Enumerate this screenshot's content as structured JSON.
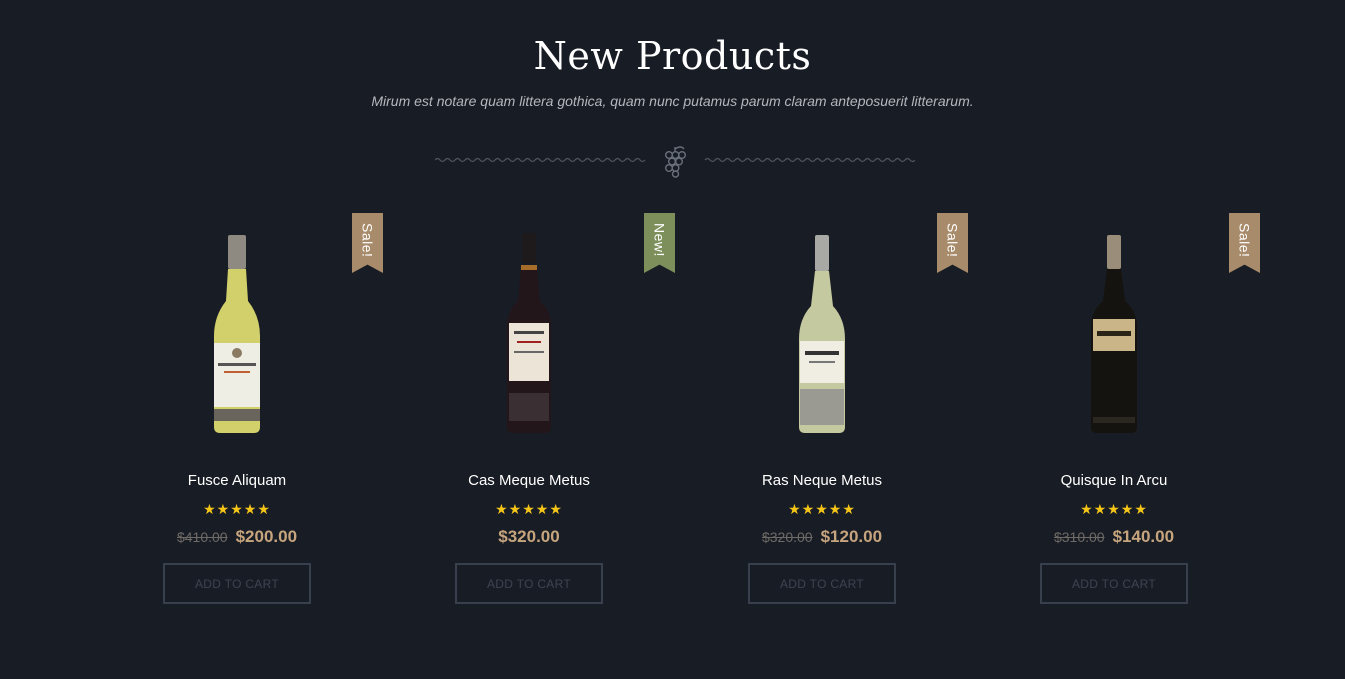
{
  "section": {
    "title": "New Products",
    "subtitle": "Mirum est notare quam littera gothica, quam nunc putamus parum claram anteposuerit litterarum."
  },
  "divider": {
    "icon": "grapes-icon"
  },
  "colors": {
    "background": "#181c24",
    "sale_ribbon": "#a88b6a",
    "new_ribbon": "#7d8f5a",
    "price": "#c6a57e",
    "star": "#f5c518"
  },
  "rating_max": 5,
  "products": [
    {
      "name": "Fusce Aliquam",
      "badge": "Sale!",
      "badge_type": "sale",
      "rating": 5,
      "old_price": "$410.00",
      "price": "$200.00",
      "button": "ADD TO CART",
      "image": "white-wine-bottle"
    },
    {
      "name": "Cas Meque Metus",
      "badge": "New!",
      "badge_type": "new",
      "rating": 5,
      "old_price": "",
      "price": "$320.00",
      "button": "ADD TO CART",
      "image": "red-wine-bottle"
    },
    {
      "name": "Ras Neque Metus",
      "badge": "Sale!",
      "badge_type": "sale",
      "rating": 5,
      "old_price": "$320.00",
      "price": "$120.00",
      "button": "ADD TO CART",
      "image": "white-wine-bottle"
    },
    {
      "name": "Quisque In Arcu",
      "badge": "Sale!",
      "badge_type": "sale",
      "rating": 5,
      "old_price": "$310.00",
      "price": "$140.00",
      "button": "ADD TO CART",
      "image": "red-wine-bottle"
    }
  ]
}
